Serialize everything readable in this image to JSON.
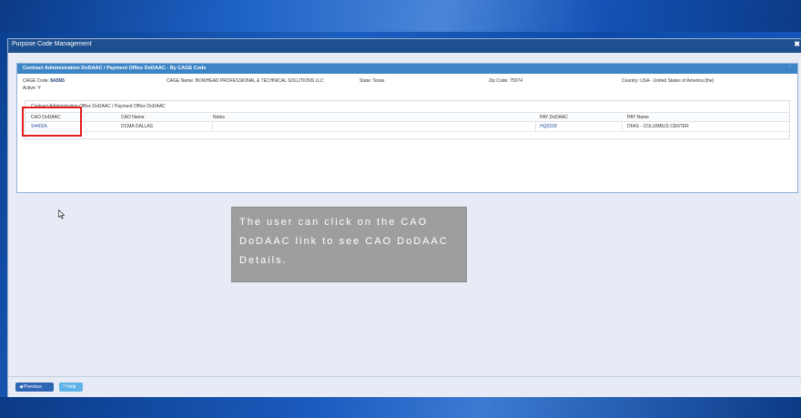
{
  "window": {
    "title": "Purpose Code Management",
    "close_glyph": "✖"
  },
  "panel": {
    "header": "Contract Administration DoDAAC / Payment Office DoDAAC - By CAGE Code",
    "cage_code_label": "CAGE Code:",
    "cage_code_value": "8A5N5",
    "active_label": "Active:",
    "active_value": "Y",
    "cage_name": "CAGE Name: BOWHEAD PROFESSIONAL & TECHNICAL SOLUTIONS LLC",
    "state": "State: Texas",
    "zip": "Zip Code: 75074",
    "country": "Country: USA - United States of America (the)"
  },
  "grid": {
    "caption": "Contract Administration Office DoDAAC / Payment Office DoDAAC",
    "columns": [
      "CAO DoDAAC",
      "CAO Name",
      "Notes",
      "PAY DoDAAC",
      "PAY Name"
    ],
    "rows": [
      {
        "cao_dodaac": "S4402A",
        "cao_name": "DCMA DALLAS",
        "notes": "",
        "pay_dodaac": "HQ0339",
        "pay_name": "DFAS - COLUMBUS CENTER"
      }
    ]
  },
  "tooltip": {
    "text": "The user can click on the CAO DoDAAC link to see CAO DoDAAC Details."
  },
  "footer": {
    "previous_label": "Previous",
    "help_label": "Help"
  },
  "colors": {
    "accent": "#3d85c6",
    "titlebar": "#1e4f8f",
    "highlight": "#e41b1b",
    "tooltip": "#9e9e9e"
  }
}
